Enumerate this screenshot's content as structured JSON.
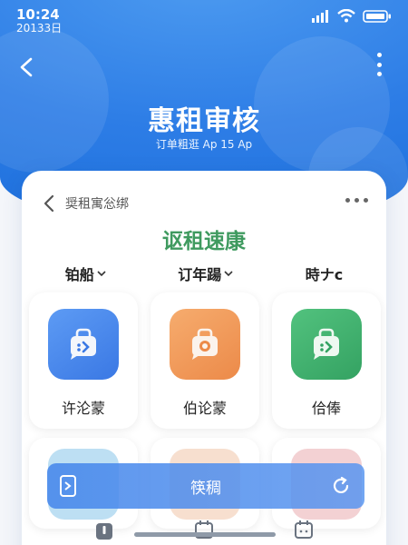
{
  "status_bar": {
    "time": "10:24",
    "date": "20133日"
  },
  "header": {
    "title": "惠租审核",
    "subtitle": "订单粗逛 Ap 15 Ap",
    "back_icon": "chevron-left-icon",
    "menu_icon": "kebab-icon"
  },
  "card": {
    "label": "奨租寓忩绑",
    "headline": "讴租速康",
    "filters": [
      {
        "label": "铂船",
        "has_chevron": true
      },
      {
        "label": "订年踼",
        "has_chevron": true
      },
      {
        "label": "時ナc",
        "has_chevron": false
      }
    ],
    "tiles": [
      {
        "label": "许沦蒙",
        "icon": "chat-bag-icon",
        "color": "#4c8df0"
      },
      {
        "label": "伯论蒙",
        "icon": "camera-bag-icon",
        "color": "#f19a5c"
      },
      {
        "label": "佮俸",
        "icon": "chat-bag-icon",
        "color": "#3fb06d"
      }
    ]
  },
  "action_bar": {
    "label": "筷稠"
  },
  "colors": {
    "brand_blue": "#2d7de6",
    "headline_green": "#3f9a5f"
  }
}
